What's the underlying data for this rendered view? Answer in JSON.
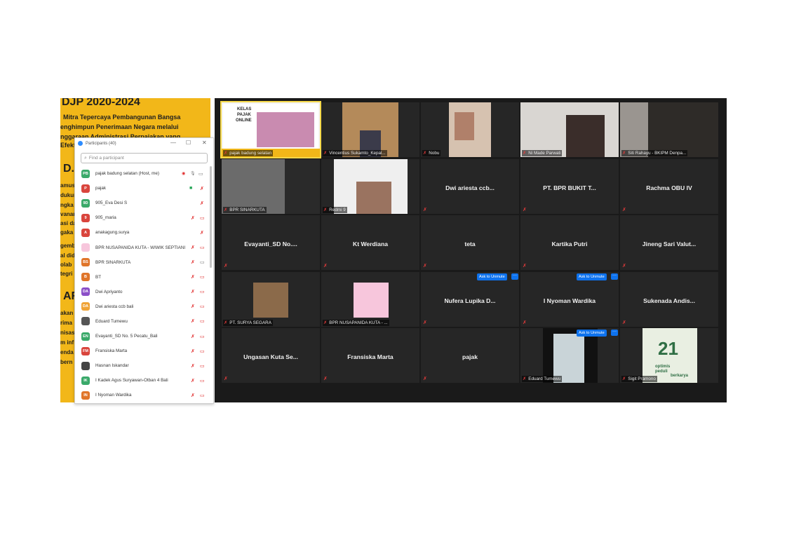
{
  "slide": {
    "title": "DJP 2020-2024",
    "lines": [
      "Mitra Tepercaya Pembangunan Bangsa",
      "enghimpun Penerimaan Negara melalui",
      "nggaraan Administrasi Perpajakan yang",
      "Efekt"
    ],
    "big1": "D.",
    "big2": "AR",
    "frags": [
      "amus",
      "dukun",
      "ngka",
      "vanan",
      "asi da",
      "gaka",
      "gemb",
      "al did",
      "olab",
      "tegri",
      "akan",
      "rima",
      "nisas",
      "m inf",
      "enda",
      "bern"
    ]
  },
  "panel": {
    "title": "Participants (40)",
    "search_placeholder": "Find a participant",
    "participants": [
      {
        "initials": "PB",
        "name": "pajak badung selatan (Host, me)",
        "color": "#3aa96a"
      },
      {
        "initials": "P",
        "name": "pajak",
        "color": "#d9453d"
      },
      {
        "initials": "9D",
        "name": "905_Eva Desi S",
        "color": "#3aa96a"
      },
      {
        "initials": "9",
        "name": "905_maria",
        "color": "#d9453d"
      },
      {
        "initials": "A",
        "name": "anakagung.surya",
        "color": "#d9453d"
      },
      {
        "initials": "",
        "name": "BPR NUSAPANIDA KUTA - WIWIK SEPTIANI",
        "color": "#f7c6dc"
      },
      {
        "initials": "BS",
        "name": "BPR SINARKUTA",
        "color": "#e0752a"
      },
      {
        "initials": "B",
        "name": "BT",
        "color": "#e0752a"
      },
      {
        "initials": "DA",
        "name": "Dwi Apriyanto",
        "color": "#8b4fc8"
      },
      {
        "initials": "DA",
        "name": "Dwi ariesta ccb bali",
        "color": "#f0a336"
      },
      {
        "initials": "",
        "name": "Eduard Tumewu",
        "color": "#555555"
      },
      {
        "initials": "EN",
        "name": "Evayanti_SD No. 5 Pecatu_Bali",
        "color": "#3aa96a"
      },
      {
        "initials": "FM",
        "name": "Fransiska Marta",
        "color": "#d9453d"
      },
      {
        "initials": "",
        "name": "Hasnan Iskandar",
        "color": "#444444"
      },
      {
        "initials": "IK",
        "name": "I Kadek Agus Suryawan-Otban 4 Bali",
        "color": "#3aa96a"
      },
      {
        "initials": "IN",
        "name": "I Nyoman Wardika",
        "color": "#e0752a"
      }
    ]
  },
  "gallery": {
    "row1": [
      "pajak badung selatan",
      "Vincentius Sukamto_Kepal...",
      "Nobu",
      "Ni Made Parwati",
      "Siti Rahayu - BKIPM Denpa..."
    ],
    "row2_labels": [
      "BPR SINARKUTA",
      "Redmi 9"
    ],
    "row2_names": [
      "Dwi ariesta ccb...",
      "PT. BPR BUKIT T...",
      "Rachma OBU IV"
    ],
    "row3_names": [
      "Evayanti_SD  No....",
      "Kt Werdiana",
      "teta",
      "Kartika Putri",
      "Jineng Sari  Valut..."
    ],
    "row4_labels": [
      "PT. SURYA SEGARA",
      "BPR NUSAPANIDA KUTA - ..."
    ],
    "row4_names": [
      "Nufera  Lupika  D...",
      "I Nyoman Wardika",
      "Sukenada  Andis..."
    ],
    "row5_names": [
      "Ungasan Kuta Se...",
      "Fransiska Marta",
      "pajak"
    ],
    "row5_labels": [
      "Eduard Tumewu",
      "Sigit Pramono"
    ],
    "ask_to_unmute": "Ask to Unmute",
    "more": "···",
    "kelas_pajak": [
      "KELAS",
      "PAJAK",
      "ONLINE"
    ],
    "badge_21": "21",
    "optimis": "optimis",
    "peduli": "peduli",
    "berkarya": "berkarya"
  }
}
